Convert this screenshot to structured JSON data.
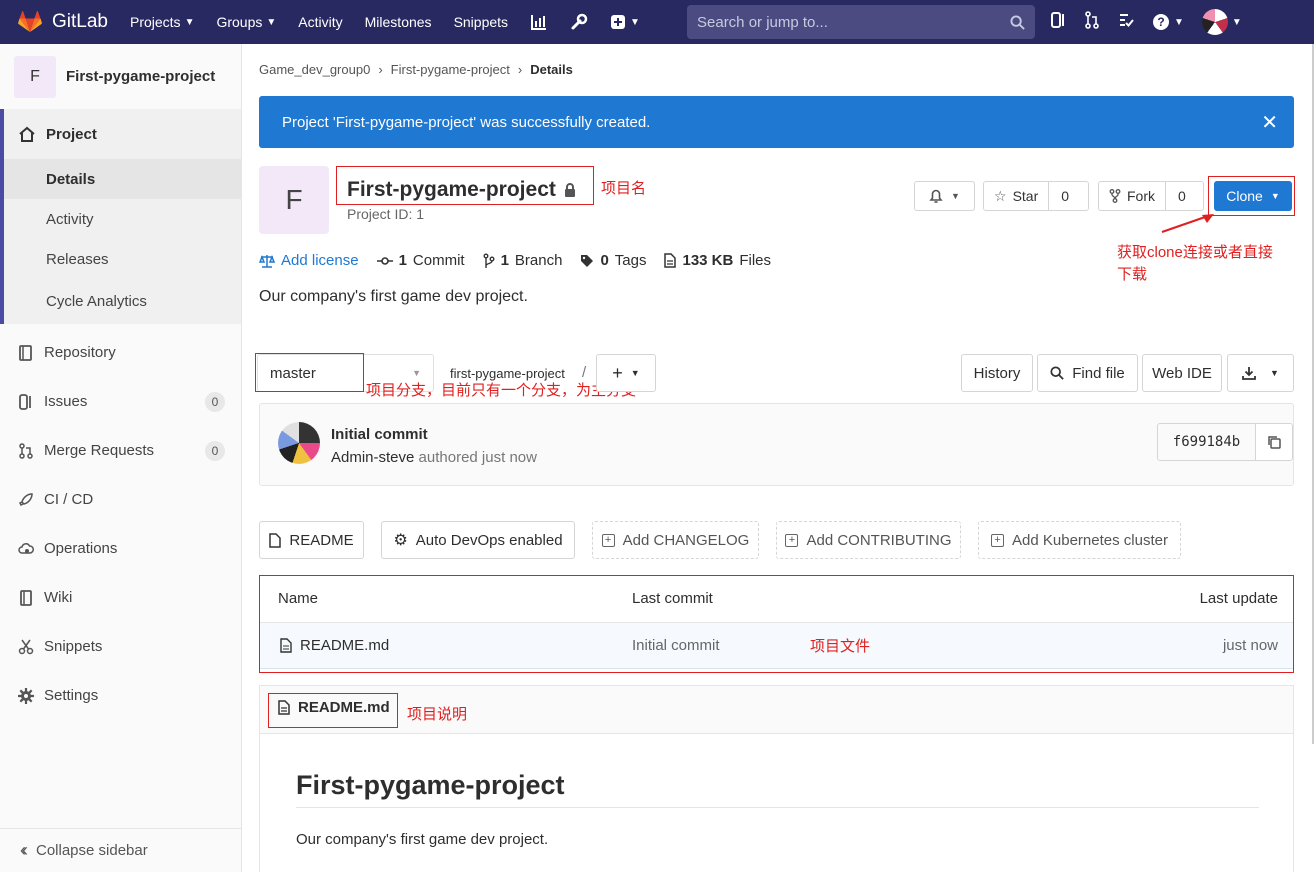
{
  "navbar": {
    "brand": "GitLab",
    "items": [
      {
        "label": "Projects",
        "dropdown": true
      },
      {
        "label": "Groups",
        "dropdown": true
      },
      {
        "label": "Activity",
        "dropdown": false
      },
      {
        "label": "Milestones",
        "dropdown": false
      },
      {
        "label": "Snippets",
        "dropdown": false
      }
    ],
    "search_placeholder": "Search or jump to..."
  },
  "sidebar": {
    "project_initial": "F",
    "project_name": "First-pygame-project",
    "section_title": "Project",
    "sub_items": [
      "Details",
      "Activity",
      "Releases",
      "Cycle Analytics"
    ],
    "items": [
      {
        "label": "Repository",
        "icon": "book-icon"
      },
      {
        "label": "Issues",
        "icon": "issues-icon",
        "badge": "0"
      },
      {
        "label": "Merge Requests",
        "icon": "merge-request-icon",
        "badge": "0"
      },
      {
        "label": "CI / CD",
        "icon": "rocket-icon"
      },
      {
        "label": "Operations",
        "icon": "cloud-gear-icon"
      },
      {
        "label": "Wiki",
        "icon": "wiki-icon"
      },
      {
        "label": "Snippets",
        "icon": "scissors-icon"
      },
      {
        "label": "Settings",
        "icon": "gear-icon"
      }
    ],
    "collapse_label": "Collapse sidebar"
  },
  "breadcrumb": [
    "Game_dev_group0",
    "First-pygame-project",
    "Details"
  ],
  "alert": "Project 'First-pygame-project' was successfully created.",
  "project": {
    "initial": "F",
    "title": "First-pygame-project",
    "id_label": "Project ID: 1",
    "star_label": "Star",
    "star_count": "0",
    "fork_label": "Fork",
    "fork_count": "0",
    "clone_label": "Clone",
    "description": "Our company's first game dev project."
  },
  "stats": {
    "license": "Add license",
    "commits_num": "1",
    "commits_label": "Commit",
    "branches_num": "1",
    "branches_label": "Branch",
    "tags_num": "0",
    "tags_label": "Tags",
    "files_num": "133 KB",
    "files_label": "Files"
  },
  "repo_toolbar": {
    "branch": "master",
    "path": "first-pygame-project",
    "separator": "/",
    "history": "History",
    "find_file": "Find file",
    "web_ide": "Web IDE"
  },
  "commit": {
    "title": "Initial commit",
    "author": "Admin-steve",
    "meta": "authored just now",
    "sha": "f699184b"
  },
  "quick_links": [
    {
      "label": "README",
      "style": "solid",
      "icon": "file-icon"
    },
    {
      "label": "Auto DevOps enabled",
      "style": "solid",
      "icon": "gear-icon"
    },
    {
      "label": "Add CHANGELOG",
      "style": "dashed",
      "icon": "plus-square-icon"
    },
    {
      "label": "Add CONTRIBUTING",
      "style": "dashed",
      "icon": "plus-square-icon"
    },
    {
      "label": "Add Kubernetes cluster",
      "style": "dashed",
      "icon": "plus-square-icon"
    }
  ],
  "file_table": {
    "headers": [
      "Name",
      "Last commit",
      "Last update"
    ],
    "rows": [
      {
        "name": "README.md",
        "last_commit": "Initial commit",
        "last_update": "just now"
      }
    ]
  },
  "readme": {
    "filename": "README.md",
    "heading": "First-pygame-project",
    "paragraph": "Our company's first game dev project."
  },
  "annotations": {
    "project_name": "项目名",
    "clone": "获取clone连接或者直接下载",
    "branch": "项目分支，目前只有一个分支，为主分支",
    "files": "项目文件",
    "readme": "项目说明"
  },
  "colors": {
    "navbar": "#292961",
    "accent": "#1f78d1",
    "annotation": "#e02020",
    "sidebar_active": "#4b4ba3"
  }
}
